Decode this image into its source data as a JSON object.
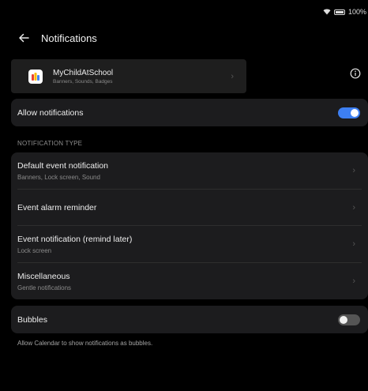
{
  "status": {
    "battery": "100%"
  },
  "header": {
    "title": "Notifications"
  },
  "app": {
    "name": "MyChildAtSchool",
    "subtitle": "Banners, Sounds, Badges"
  },
  "allow": {
    "label": "Allow notifications",
    "enabled": true
  },
  "section": {
    "label": "NOTIFICATION TYPE"
  },
  "types": [
    {
      "title": "Default event notification",
      "subtitle": "Banners, Lock screen, Sound"
    },
    {
      "title": "Event alarm reminder",
      "subtitle": ""
    },
    {
      "title": "Event notification (remind later)",
      "subtitle": "Lock screen"
    },
    {
      "title": "Miscellaneous",
      "subtitle": "Gentle notifications"
    }
  ],
  "bubbles": {
    "label": "Bubbles",
    "enabled": false,
    "note": "Allow Calendar to show notifications as bubbles."
  },
  "colors": {
    "accent": "#3d7ff2",
    "surface": "#1c1c1e",
    "background": "#000000"
  },
  "icons": {
    "back": "arrow-left-icon",
    "info": "info-circle-icon",
    "chevron": "chevron-right-icon",
    "wifi": "wifi-icon",
    "battery": "battery-icon"
  }
}
